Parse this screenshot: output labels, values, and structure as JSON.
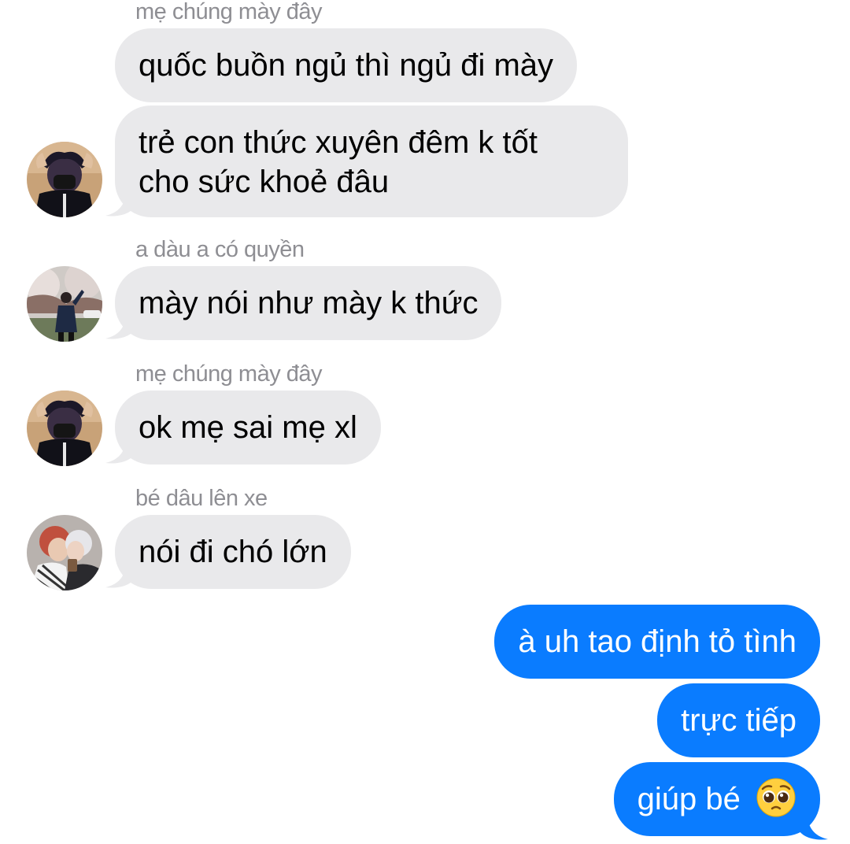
{
  "messages": [
    {
      "type": "sender",
      "text": "mẹ chúng mày đây"
    },
    {
      "type": "incoming",
      "text": "quốc buồn ngủ thì ngủ đi mày"
    },
    {
      "type": "incoming",
      "lines": [
        "trẻ con thức xuyên đêm k tốt",
        "cho sức khoẻ đâu"
      ]
    },
    {
      "type": "sender",
      "text": "a dàu a có quyền"
    },
    {
      "type": "incoming",
      "text": "mày nói như mày k thức"
    },
    {
      "type": "sender",
      "text": "mẹ chúng mày đây"
    },
    {
      "type": "incoming",
      "text": "ok mẹ sai mẹ xl"
    },
    {
      "type": "sender",
      "text": "bé dâu lên xe"
    },
    {
      "type": "incoming",
      "text": "nói đi chó lớn"
    },
    {
      "type": "outgoing",
      "text": "à uh tao định tỏ tình"
    },
    {
      "type": "outgoing",
      "text": "trực tiếp"
    },
    {
      "type": "outgoing",
      "text": "giúp bé",
      "emoji": "pleading-face-emoji"
    }
  ],
  "avatars": [
    {
      "name": "masked-person-photo"
    },
    {
      "name": "person-under-cherry-blossoms-photo"
    },
    {
      "name": "masked-person-photo"
    },
    {
      "name": "two-people-photo"
    }
  ],
  "colors": {
    "incoming_bubble": "#e9e9eb",
    "outgoing_bubble": "#0a7cff",
    "sender_label": "#8e8e93",
    "background": "#ffffff"
  }
}
